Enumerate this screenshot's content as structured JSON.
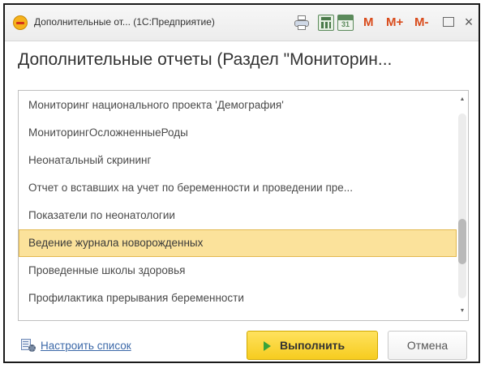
{
  "window": {
    "title": "Дополнительные от... (1С:Предприятие)",
    "calendar_day": "31",
    "mem_buttons": [
      "M",
      "M+",
      "M-"
    ],
    "close_glyph": "×"
  },
  "form": {
    "title": "Дополнительные отчеты (Раздел \"Мониторин..."
  },
  "list": {
    "items": [
      "Мониторинг национального проекта 'Демография'",
      "МониторингОсложненныеРоды",
      "Неонатальный скрининг",
      "Отчет о вставших на учет по беременности и проведении пре...",
      "Показатели по неонатологии",
      "Ведение журнала новорожденных",
      "Проведенные школы здоровья",
      "Профилактика прерывания беременности"
    ],
    "selected_index": 5
  },
  "footer": {
    "configure_link": "Настроить список",
    "run_button": "Выполнить",
    "cancel_button": "Отмена"
  },
  "colors": {
    "selected_row": "#fbe29b",
    "run_button": "#f6cc1f",
    "link": "#3b68a8",
    "mem_buttons": "#d94b1b"
  }
}
